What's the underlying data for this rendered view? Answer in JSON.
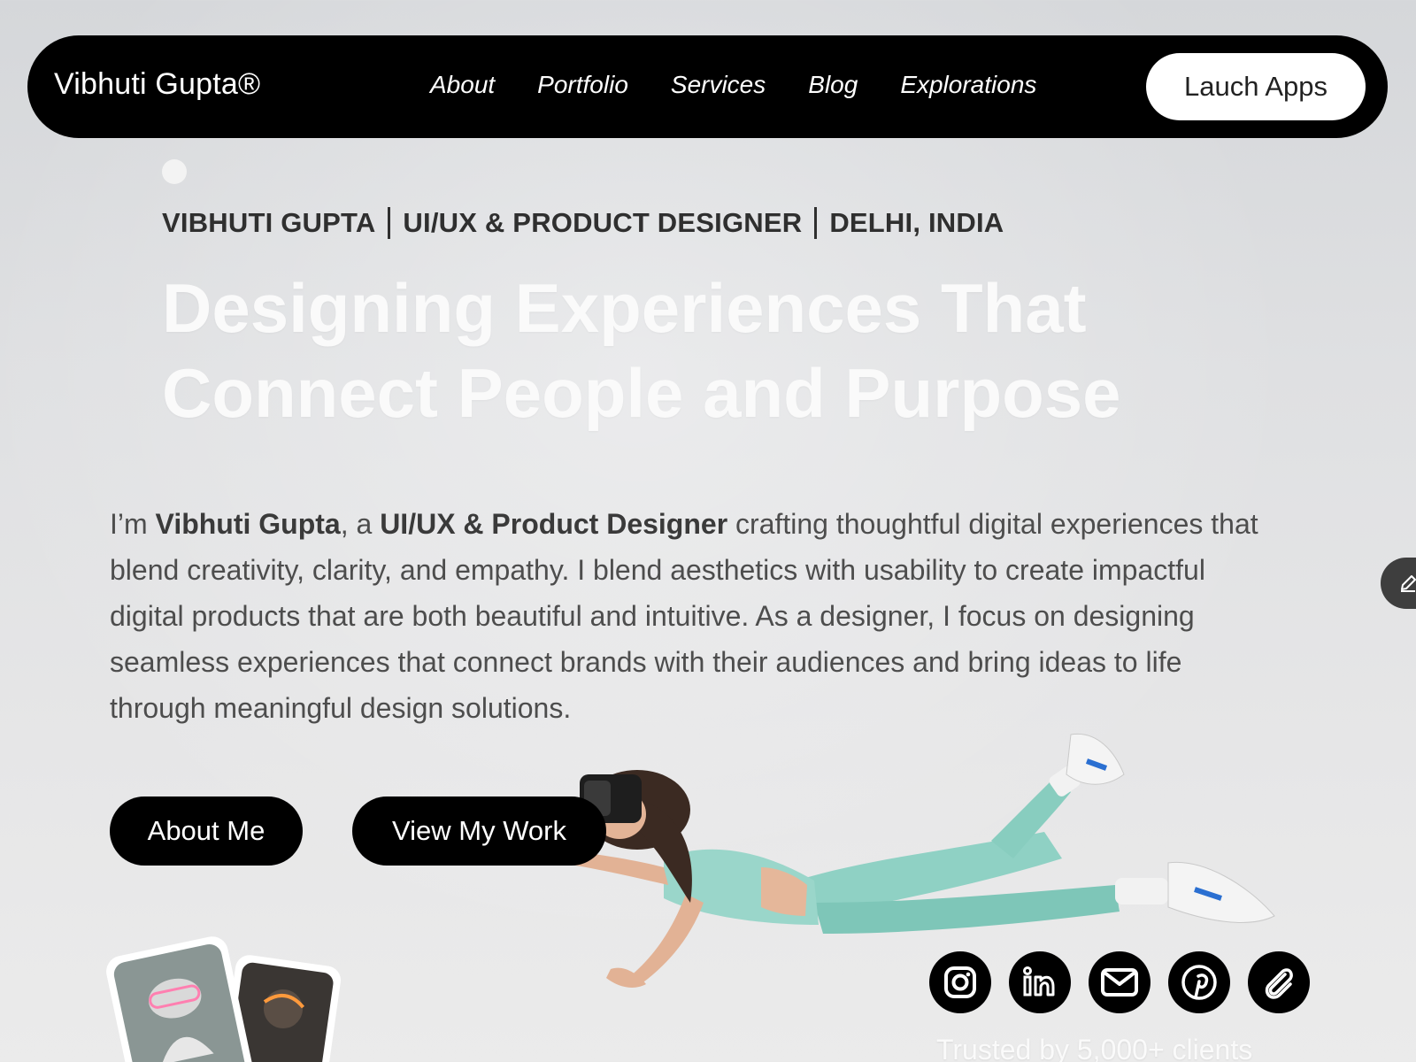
{
  "navbar": {
    "brand": "Vibhuti Gupta®",
    "links": [
      "About",
      "Portfolio",
      "Services",
      "Blog",
      "Explorations"
    ],
    "cta_label": "Lauch Apps"
  },
  "hero": {
    "tagline": [
      "VIBHUTI GUPTA",
      "UI/UX & PRODUCT DESIGNER",
      "DELHI, INDIA"
    ],
    "headline_line1": "Designing Experiences That",
    "headline_line2": "Connect People and Purpose",
    "desc": {
      "prefix": "I’m ",
      "name": "Vibhuti Gupta",
      "mid": ", a ",
      "role": "UI/UX & Product Designer",
      "rest": " crafting thoughtful digital experiences that blend creativity, clarity, and empathy. I blend aesthetics with usability to create impactful digital products that are both beautiful and intuitive. As a designer, I focus on designing seamless experiences that connect brands with their audiences and bring ideas to life through meaningful design solutions."
    },
    "buttons": {
      "about": "About Me",
      "work": "View My Work"
    }
  },
  "socials": {
    "icons": [
      "instagram-icon",
      "linkedin-icon",
      "mail-icon",
      "pinterest-icon",
      "attachment-icon"
    ]
  },
  "trusted_text": "Trusted by 5,000+ clients",
  "colors": {
    "nav_bg": "#000000",
    "button_bg": "#000000",
    "headline": "#fafafa"
  }
}
